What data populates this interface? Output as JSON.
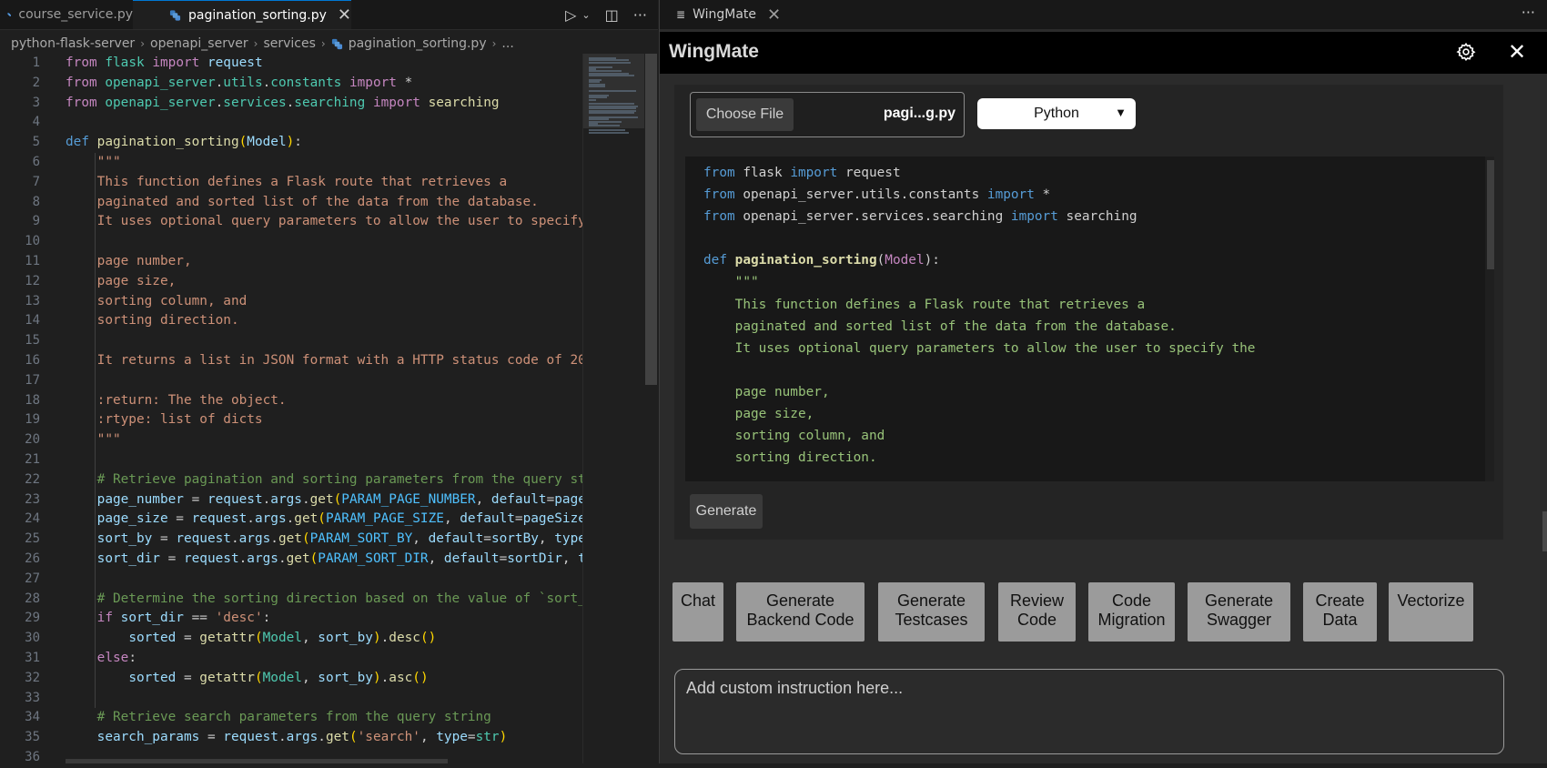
{
  "editor": {
    "tabs": [
      {
        "label": "course_service.py",
        "icon": "python-file-icon",
        "active": false
      },
      {
        "label": "pagination_sorting.py",
        "icon": "python-file-icon",
        "active": true
      }
    ],
    "tab_actions": [
      "run-icon",
      "split-editor-icon",
      "more-actions-icon"
    ],
    "breadcrumb": [
      "python-flask-server",
      "openapi_server",
      "services",
      "pagination_sorting.py",
      "..."
    ],
    "line_numbers": [
      "1",
      "2",
      "3",
      "4",
      "5",
      "6",
      "7",
      "8",
      "9",
      "10",
      "11",
      "12",
      "13",
      "14",
      "15",
      "16",
      "17",
      "18",
      "19",
      "20",
      "21",
      "22",
      "23",
      "24",
      "25",
      "26",
      "27",
      "28",
      "29",
      "30",
      "31",
      "32",
      "33",
      "34",
      "35",
      "36"
    ]
  },
  "panel": {
    "tab_label": "WingMate",
    "title": "WingMate",
    "file_button": "Choose File",
    "file_name": "pagi...g.py",
    "language": "Python",
    "generate_label": "Generate",
    "actions": [
      {
        "line1": "Chat",
        "line2": ""
      },
      {
        "line1": "Generate",
        "line2": "Backend Code"
      },
      {
        "line1": "Generate",
        "line2": "Testcases"
      },
      {
        "line1": "Review",
        "line2": "Code"
      },
      {
        "line1": "Code",
        "line2": "Migration"
      },
      {
        "line1": "Generate",
        "line2": "Swagger"
      },
      {
        "line1": "Create",
        "line2": "Data"
      },
      {
        "line1": "Vectorize",
        "line2": ""
      }
    ],
    "custom_placeholder": "Add custom instruction here..."
  },
  "colors": {
    "editor_bg": "#1f1f1f",
    "accent": "#0078d4",
    "action_button": "#9b9b9b",
    "header_bg": "#000000"
  }
}
